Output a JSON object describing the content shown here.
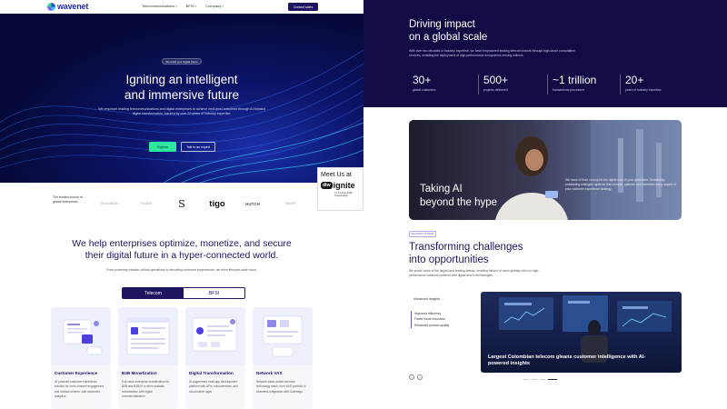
{
  "nav": {
    "logo_text": "wavenet",
    "menu": [
      {
        "label": "Telecommunications"
      },
      {
        "label": "BFSI"
      },
      {
        "label": "Company"
      }
    ],
    "contact_label": "Contact sales"
  },
  "hero": {
    "pill": "We build your digital future",
    "title_line1": "Igniting an intelligent",
    "title_line2": "and immersive future",
    "subtitle": "We empower leading telecommunications and digital enterprises to achieve next-level outcomes through AI-forward digital transformation, backed by over 20 years of industry expertise.",
    "primary_button": "Explore",
    "secondary_button": "Talk to an expert"
  },
  "event": {
    "title": "Meet Us at",
    "badge": "dtw",
    "name": "ignite",
    "date": "17-19 June 2025 Copenhagen"
  },
  "trust": {
    "label": "The trusted choice of global enterprises",
    "logos": [
      "TELKOMSEL",
      "GLOBE",
      "S",
      "tigo",
      "HUTCH",
      "SMART"
    ]
  },
  "solutions": {
    "title_line1": "We help enterprises optimize, monetize, and secure",
    "title_line2": "their digital future in a hyper-connected world.",
    "subtitle": "From powering mission-critical operations to elevating customer experiences, we drive lifecycle-wide value.",
    "tabs": [
      "Telecom",
      "BFSI"
    ],
    "cards": [
      {
        "title": "Customer Experience",
        "desc": "AI-powered customer experience solution for omni-channel engagement and contact centres, with advanced analytics"
      },
      {
        "title": "B2B Monetization",
        "desc": "Full-stack enterprise monetization for B2B and B2B2X to drive scalable monetization with digital commercialization"
      },
      {
        "title": "Digital Transformation",
        "desc": "AI-augmented multi-app development platform with APIs, microservices, and cloud-native apps"
      },
      {
        "title": "Network VAS",
        "desc": "Network value-added services technology stack, from VAS portfolio to seamless integration with Gateways"
      }
    ]
  },
  "impact": {
    "title_line1": "Driving impact",
    "title_line2": "on a global scale",
    "subtitle": "With over two decades of industry expertise, we have empowered leading telecom brands through high-touch consultative services, enabling the deployment of high-performance ecosystems serving millions.",
    "stats": [
      {
        "value": "30+",
        "label": "global customers"
      },
      {
        "value": "500+",
        "label": "projects delivered"
      },
      {
        "value": "~1 trillion",
        "label": "transactions processed"
      },
      {
        "value": "20+",
        "label": "years of industry expertise"
      }
    ]
  },
  "ai_card": {
    "title_line1": "Taking AI",
    "title_line2": "beyond the hype",
    "desc": "We move AI from concept to the digital core of your operations. Seamlessly embedding intelligent systems that connect, optimize and transform every aspect of your customer experience strategy."
  },
  "challenges": {
    "badge": "SUCCESS STORIES",
    "title_line1": "Transforming challenges",
    "title_line2": "into opportunities",
    "subtitle": "We power some of the largest and leading brands, enabling billions of users globally with our high-performance solutions powered with digital and AI technologies.",
    "adv_label": "Advanced insights",
    "adv_items": [
      "Improved efficiency",
      "Faster issue resolution",
      "Enhanced product quality"
    ],
    "case_text": "Largest Colombian telecom gleans customer intelligence with AI-powered insights"
  }
}
